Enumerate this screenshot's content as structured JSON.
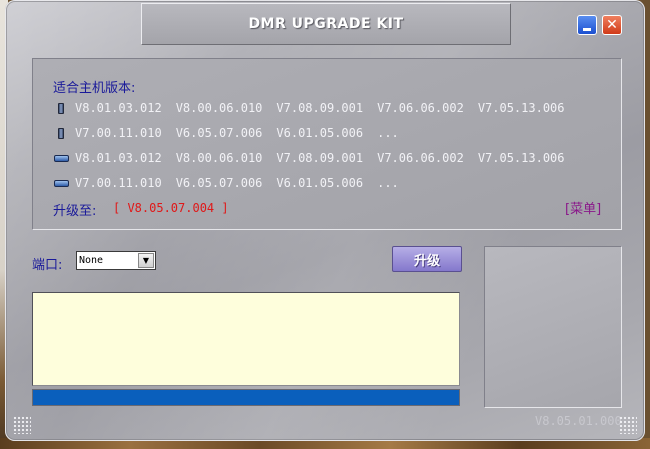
{
  "window": {
    "title": "DMR UPGRADE KIT",
    "minimize_icon": "minimize-icon",
    "close_glyph": "✕"
  },
  "compat": {
    "heading": "适合主机版本:",
    "rows": [
      {
        "icon": "handheld-radio-icon",
        "versions": [
          "V8.01.03.012",
          "V8.00.06.010",
          "V7.08.09.001",
          "V7.06.06.002",
          "V7.05.13.006"
        ]
      },
      {
        "icon": "handheld-radio-icon",
        "versions": [
          "V7.00.11.010",
          "V6.05.07.006",
          "V6.01.05.006",
          "..."
        ]
      },
      {
        "icon": "mobile-radio-icon",
        "versions": [
          "V8.01.03.012",
          "V8.00.06.010",
          "V7.08.09.001",
          "V7.06.06.002",
          "V7.05.13.006"
        ]
      },
      {
        "icon": "mobile-radio-icon",
        "versions": [
          "V7.00.11.010",
          "V6.05.07.006",
          "V6.01.05.006",
          "..."
        ]
      }
    ],
    "upgrade_label": "升级至:",
    "upgrade_version": "[ V8.05.07.004 ]",
    "menu_label": "[菜单]"
  },
  "port": {
    "label": "端口:",
    "value": "None"
  },
  "upgrade_button": "升级",
  "log_text": "",
  "progress": 1.0,
  "app_version": "V8.05.01.000",
  "colors": {
    "label_blue": "#1a1a9a",
    "upgrade_red": "#e01818",
    "menu_purple": "#8a188a",
    "progress_blue": "#0a5fbc",
    "log_bg": "#fefedc"
  }
}
